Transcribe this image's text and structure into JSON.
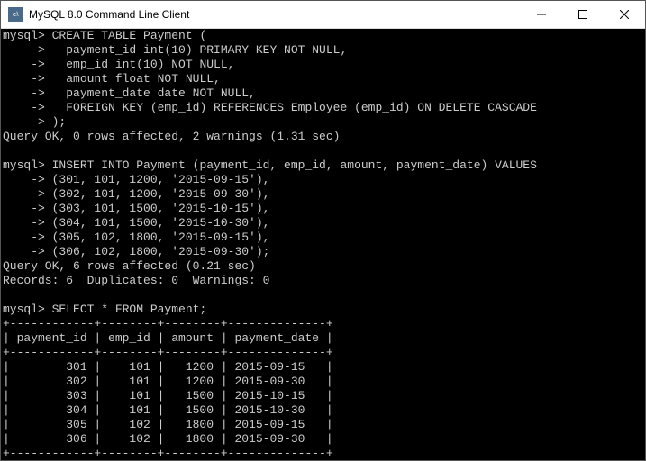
{
  "window": {
    "title": "MySQL 8.0 Command Line Client",
    "icon_label": "c:\\"
  },
  "prompt": "mysql>",
  "cont": "    ->",
  "create_table": {
    "line1": " CREATE TABLE Payment (",
    "col1": "   payment_id int(10) PRIMARY KEY NOT NULL,",
    "col2": "   emp_id int(10) NOT NULL,",
    "col3": "   amount float NOT NULL,",
    "col4": "   payment_date date NOT NULL,",
    "fk": "   FOREIGN KEY (emp_id) REFERENCES Employee (emp_id) ON DELETE CASCADE",
    "close": " );"
  },
  "create_result": "Query OK, 0 rows affected, 2 warnings (1.31 sec)",
  "insert": {
    "line1": " INSERT INTO Payment (payment_id, emp_id, amount, payment_date) VALUES",
    "r1": " (301, 101, 1200, '2015-09-15'),",
    "r2": " (302, 101, 1200, '2015-09-30'),",
    "r3": " (303, 101, 1500, '2015-10-15'),",
    "r4": " (304, 101, 1500, '2015-10-30'),",
    "r5": " (305, 102, 1800, '2015-09-15'),",
    "r6": " (306, 102, 1800, '2015-09-30');"
  },
  "insert_result1": "Query OK, 6 rows affected (0.21 sec)",
  "insert_result2": "Records: 6  Duplicates: 0  Warnings: 0",
  "select": {
    "cmd": " SELECT * FROM Payment;",
    "border": "+------------+--------+--------+--------------+",
    "header": "| payment_id | emp_id | amount | payment_date |",
    "row1": "|        301 |    101 |   1200 | 2015-09-15   |",
    "row2": "|        302 |    101 |   1200 | 2015-09-30   |",
    "row3": "|        303 |    101 |   1500 | 2015-10-15   |",
    "row4": "|        304 |    101 |   1500 | 2015-10-30   |",
    "row5": "|        305 |    102 |   1800 | 2015-09-15   |",
    "row6": "|        306 |    102 |   1800 | 2015-09-30   |"
  },
  "chart_data": {
    "type": "table",
    "title": "SELECT * FROM Payment",
    "columns": [
      "payment_id",
      "emp_id",
      "amount",
      "payment_date"
    ],
    "rows": [
      [
        301,
        101,
        1200,
        "2015-09-15"
      ],
      [
        302,
        101,
        1200,
        "2015-09-30"
      ],
      [
        303,
        101,
        1500,
        "2015-10-15"
      ],
      [
        304,
        101,
        1500,
        "2015-10-30"
      ],
      [
        305,
        102,
        1800,
        "2015-09-15"
      ],
      [
        306,
        102,
        1800,
        "2015-09-30"
      ]
    ]
  }
}
